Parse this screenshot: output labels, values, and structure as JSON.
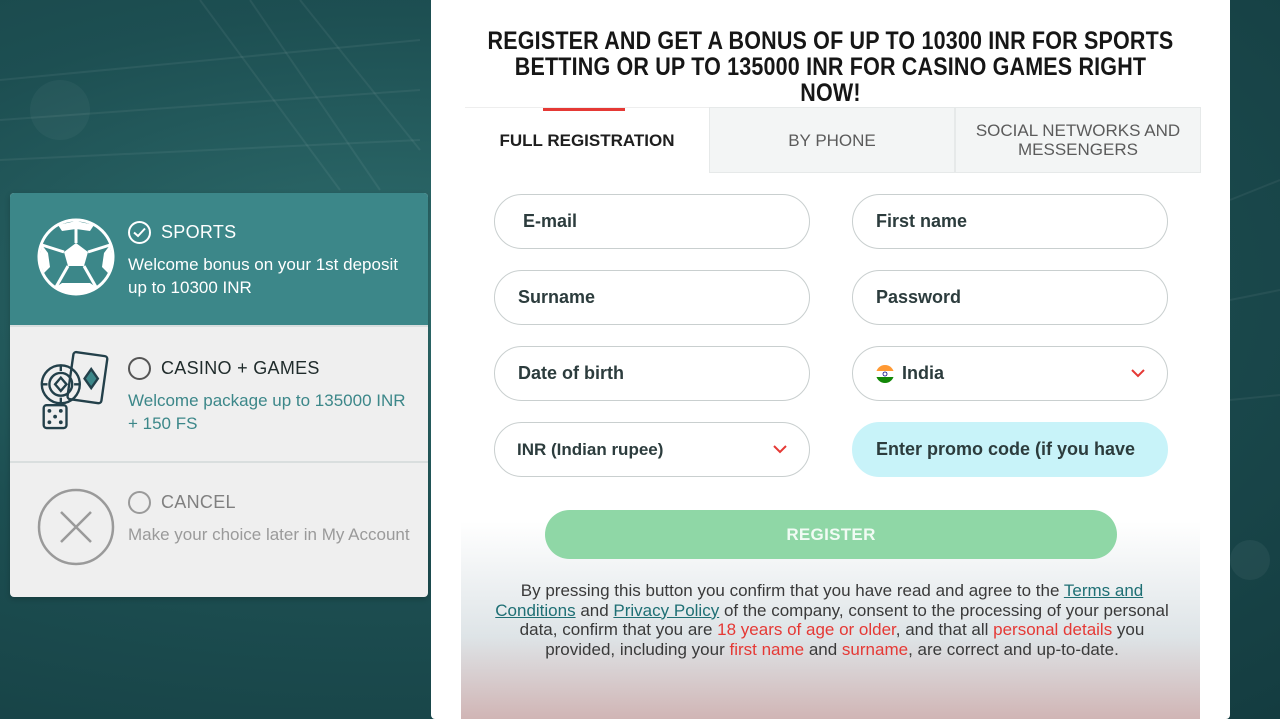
{
  "headline": "REGISTER AND GET A BONUS OF UP TO 10300 INR FOR SPORTS BETTING OR UP TO 135000 INR FOR CASINO GAMES RIGHT NOW!",
  "tabs": [
    {
      "label": "FULL REGISTRATION",
      "active": true
    },
    {
      "label": "BY PHONE",
      "active": false
    },
    {
      "label": "SOCIAL NETWORKS AND MESSENGERS",
      "active": false
    }
  ],
  "bonuses": [
    {
      "title": "SPORTS",
      "desc": "Welcome bonus on your 1st deposit up to 10300 INR",
      "selected": true,
      "icon": "soccer-ball-icon"
    },
    {
      "title": "CASINO + GAMES",
      "desc": "Welcome package up to 135000 INR + 150 FS",
      "selected": false,
      "icon": "casino-chips-cards-dice-icon"
    },
    {
      "title": "CANCEL",
      "desc": "Make your choice later in My Account",
      "selected": false,
      "icon": "close-circle-icon"
    }
  ],
  "form": {
    "email_placeholder": "E-mail",
    "first_name_placeholder": "First name",
    "surname_placeholder": "Surname",
    "password_placeholder": "Password",
    "dob_placeholder": "Date of birth",
    "country": "India",
    "currency": "INR (Indian rupee)",
    "promo_placeholder": "Enter promo code (if you have"
  },
  "register_label": "REGISTER",
  "disclaimer": {
    "part1": "By pressing this button you confirm that you have read and agree to the ",
    "terms_link": "Terms and Conditions",
    "part2": " and ",
    "privacy_link": "Privacy Policy",
    "part3": " of the company, consent to the processing of your personal data, confirm that you are ",
    "age": "18 years of age or older",
    "part4": ", and that all ",
    "personal": "personal details",
    "part5": " you provided, including your ",
    "first_name": "first name",
    "part6": " and ",
    "surname": "surname",
    "part7": ", are correct and up-to-date."
  },
  "colors": {
    "accent_teal": "#3c8789",
    "accent_red": "#e53935",
    "register_green": "#8fd7a6",
    "promo_bg": "#c8f3f9"
  }
}
